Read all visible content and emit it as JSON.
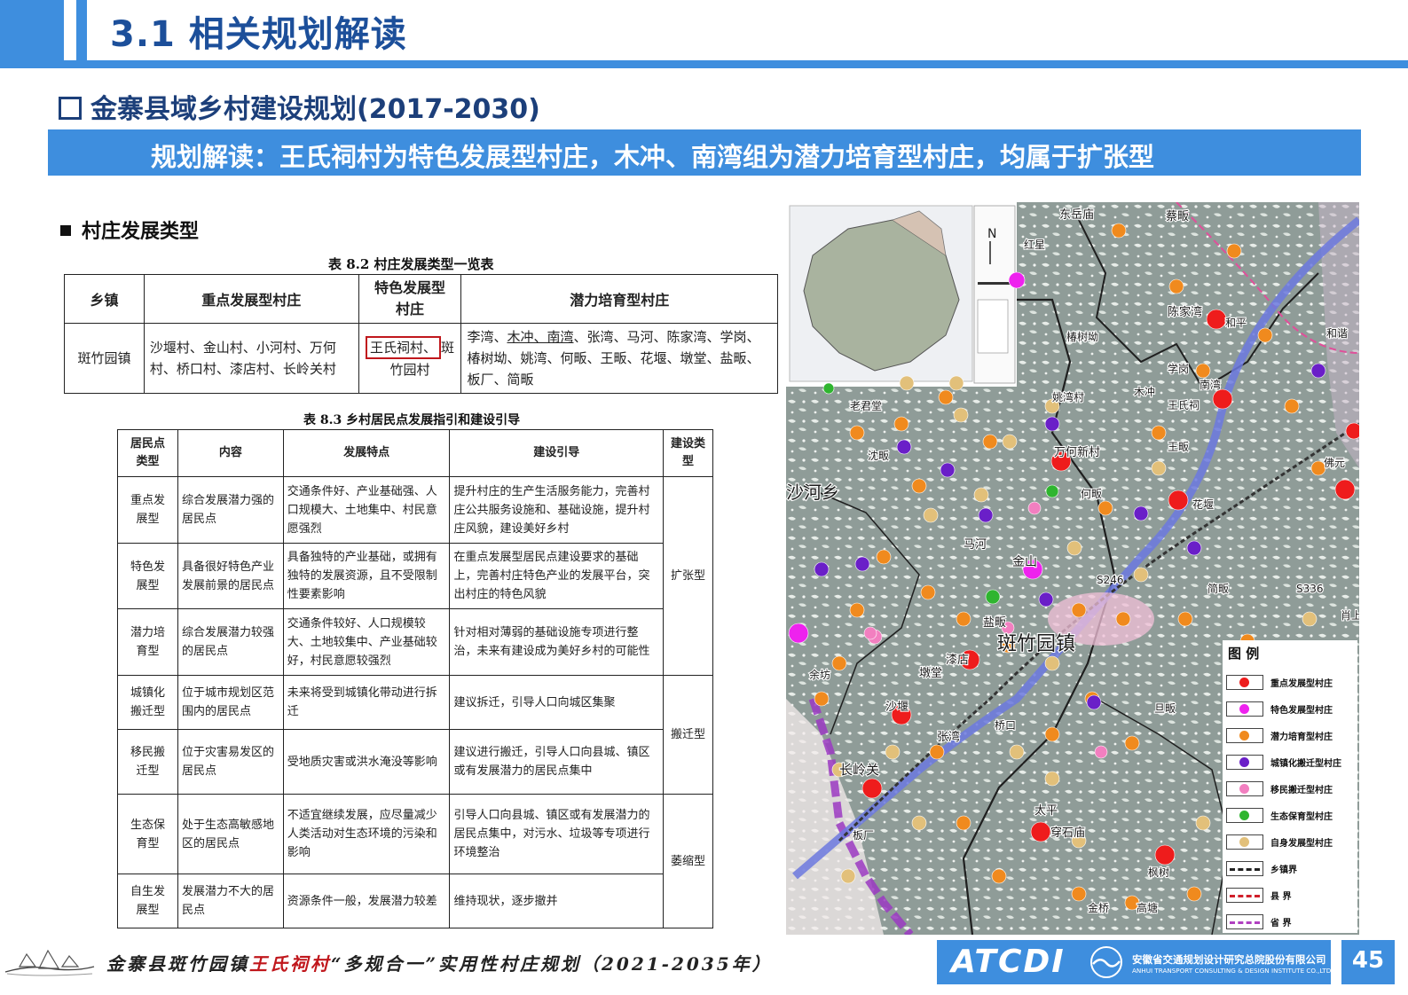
{
  "header": {
    "title": "3.1 相关规划解读"
  },
  "section": {
    "title": "金寨县域乡村建设规划(2017-2030)"
  },
  "banner": {
    "text": "规划解读：王氏祠村为特色发展型村庄，木冲、南湾组为潜力培育型村庄，均属于扩张型"
  },
  "subsection": {
    "title": "村庄发展类型"
  },
  "table82": {
    "caption": "表 8.2 村庄发展类型一览表",
    "headers": [
      "乡镇",
      "重点发展型村庄",
      "特色发展型村庄",
      "潜力培育型村庄"
    ],
    "row": {
      "town": "斑竹园镇",
      "key": "沙堰村、金山村、小河村、万何村、桥口村、漆店村、长岭关村",
      "special_highlight": "王氏祠村、",
      "special_rest": "斑竹园村",
      "potential_pre": "李湾、",
      "potential_u1": "木冲、南湾",
      "potential_post": "、张湾、马河、陈家湾、学岗、椿树坳、姚湾、何畈、王畈、花堰、墩堂、盐畈、板厂、简畈"
    }
  },
  "table83": {
    "caption": "表 8.3 乡村居民点发展指引和建设引导",
    "headers": [
      "居民点类型",
      "内容",
      "发展特点",
      "建设引导",
      "建设类型"
    ],
    "rows": [
      {
        "type": "重点发展型",
        "content": "综合发展潜力强的居民点",
        "feature": "交通条件好、产业基础强、人口规模大、土地集中、村民意愿强烈",
        "guide": "提升村庄的生产生活服务能力，完善村庄公共服务设施和、基础设施，提升村庄风貌，建设美好乡村"
      },
      {
        "type": "特色发展型",
        "content": "具备很好特色产业发展前景的居民点",
        "feature": "具备独特的产业基础，或拥有独特的发展资源，且不受限制性要素影响",
        "guide": "在重点发展型居民点建设要求的基础上，完善村庄特色产业的发展平台，突出村庄的特色风貌"
      },
      {
        "type": "潜力培育型",
        "content": "综合发展潜力较强的居民点",
        "feature": "交通条件较好、人口规模较大、土地较集中、产业基础较好，村民意愿较强烈",
        "guide": "针对相对薄弱的基础设施专项进行整治，未来有建设成为美好乡村的可能性"
      },
      {
        "type": "城镇化搬迁型",
        "content": "位于城市规划区范围内的居民点",
        "feature": "未来将受到城镇化带动进行拆迁",
        "guide": "建议拆迁，引导人口向城区集聚"
      },
      {
        "type": "移民搬迁型",
        "content": "位于灾害易发区的居民点",
        "feature": "受地质灾害或洪水淹没等影响",
        "guide": "建议进行搬迁，引导人口向县城、镇区或有发展潜力的居民点集中"
      },
      {
        "type": "生态保育型",
        "content": "处于生态高敏感地区的居民点",
        "feature": "不适宜继续发展，应尽量减少人类活动对生态环境的污染和影响",
        "guide": "引导人口向县城、镇区或有发展潜力的居民点集中，对污水、垃圾等专项进行环境整治"
      },
      {
        "type": "自生发展型",
        "content": "发展潜力不大的居民点",
        "feature": "资源条件一般，发展潜力较差",
        "guide": "维持现状，逐步撤并"
      }
    ],
    "build_types": [
      "扩张型",
      "搬迁型",
      "萎缩型"
    ]
  },
  "map": {
    "legend_title": "图 例",
    "legend": [
      {
        "label": "重点发展型村庄",
        "color": "#ee1c1c",
        "kind": "dot"
      },
      {
        "label": "特色发展型村庄",
        "color": "#ee22ee",
        "kind": "dot"
      },
      {
        "label": "潜力培育型村庄",
        "color": "#f08a1e",
        "kind": "dot"
      },
      {
        "label": "城镇化搬迁型村庄",
        "color": "#6a1fc8",
        "kind": "dot"
      },
      {
        "label": "移民搬迁型村庄",
        "color": "#f27fc0",
        "kind": "dot"
      },
      {
        "label": "生态保育型村庄",
        "color": "#2fb52f",
        "kind": "dot"
      },
      {
        "label": "自身发展型村庄",
        "color": "#e2c07a",
        "kind": "dot"
      },
      {
        "label": "乡镇界",
        "color": "#222222",
        "kind": "line"
      },
      {
        "label": "县 界",
        "color": "#d01f2a",
        "kind": "line"
      },
      {
        "label": "省 界",
        "color": "#b040c0",
        "kind": "line"
      }
    ],
    "place_labels": [
      "东岳庙",
      "蔡畈",
      "红星",
      "陈家湾",
      "和平",
      "沙河乡",
      "长岭关",
      "斑竹园镇",
      "金山",
      "漆店",
      "沙堰",
      "马河",
      "盐畈",
      "墩堂",
      "张湾",
      "太平",
      "穿石庙",
      "桥口",
      "万何新村",
      "王氏祠",
      "木冲",
      "南湾",
      "学岗",
      "姚湾村",
      "椿树坳",
      "王畈",
      "花堰",
      "简畈",
      "何畈",
      "老君堂",
      "沈畈",
      "余坊",
      "板厂",
      "旦畈",
      "枫树",
      "金桥",
      "高塘",
      "肖上湾",
      "佛元",
      "和谐",
      "S246",
      "S336"
    ]
  },
  "footer": {
    "title_pre": "金寨县斑竹园镇",
    "title_red": "王氏祠村",
    "title_post": "“多规合一”实用性村庄规划（2021-2035年）",
    "logo": "ATCDI",
    "company_cn": "安徽省交通规划设计研究总院股份有限公司",
    "company_en": "ANHUI TRANSPORT CONSULTING & DESIGN INSTITUTE CO.,LTD.",
    "page": "45"
  }
}
